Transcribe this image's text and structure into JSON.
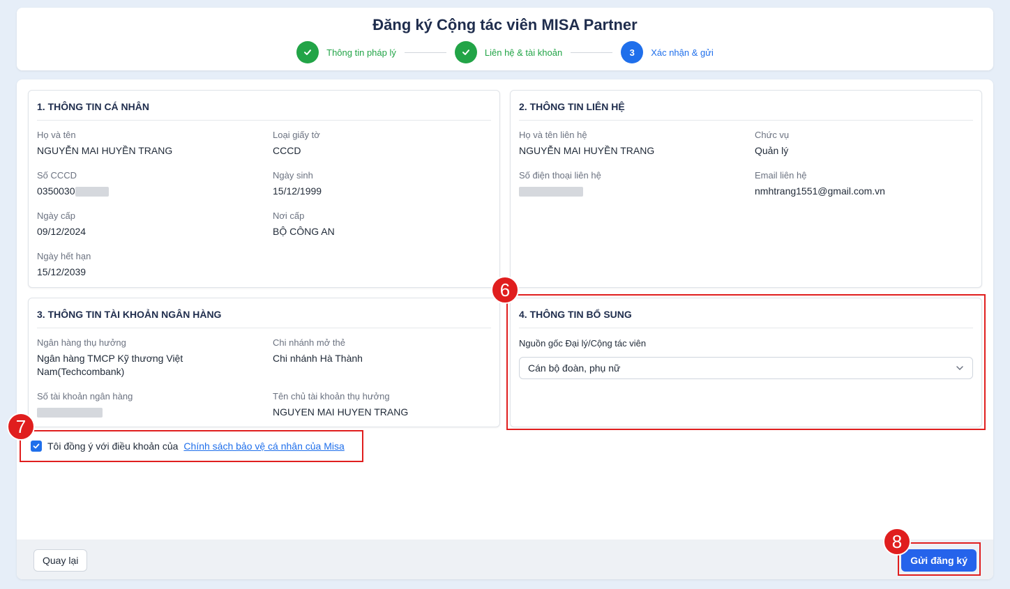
{
  "header": {
    "title": "Đăng ký Cộng tác viên MISA Partner",
    "steps": [
      {
        "label": "Thông tin pháp lý",
        "status": "done"
      },
      {
        "label": "Liên hệ & tài khoản",
        "status": "done"
      },
      {
        "label": "Xác nhận & gửi",
        "status": "active",
        "number": "3"
      }
    ]
  },
  "personal": {
    "title": "1. THÔNG TIN CÁ NHÂN",
    "full_name_label": "Họ và tên",
    "full_name": "NGUYỄN MAI HUYỀN TRANG",
    "doc_type_label": "Loại giấy tờ",
    "doc_type": "CCCD",
    "id_label": "Số CCCD",
    "id_value": "0350030",
    "dob_label": "Ngày sinh",
    "dob": "15/12/1999",
    "issue_date_label": "Ngày cấp",
    "issue_date": "09/12/2024",
    "issue_place_label": "Nơi cấp",
    "issue_place": "BỘ CÔNG AN",
    "expiry_label": "Ngày hết hạn",
    "expiry": "15/12/2039"
  },
  "contact": {
    "title": "2. THÔNG TIN LIÊN HỆ",
    "name_label": "Họ và tên liên hệ",
    "name": "NGUYỄN MAI HUYỀN TRANG",
    "role_label": "Chức vụ",
    "role": "Quản lý",
    "phone_label": "Số điện thoại liên hệ",
    "email_label": "Email liên hệ",
    "email": "nmhtrang1551@gmail.com.vn"
  },
  "bank": {
    "title": "3. THÔNG TIN TÀI KHOẢN NGÂN HÀNG",
    "bank_label": "Ngân hàng thụ hưởng",
    "bank": "Ngân hàng TMCP Kỹ thương Việt Nam(Techcombank)",
    "branch_label": "Chi nhánh mở thẻ",
    "branch": "Chi nhánh Hà Thành",
    "account_label": "Số tài khoản ngân hàng",
    "holder_label": "Tên chủ tài khoản thụ hưởng",
    "holder": "NGUYEN MAI HUYEN TRANG"
  },
  "extra": {
    "title": "4. THÔNG TIN BỔ SUNG",
    "source_label": "Nguồn gốc Đại lý/Cộng tác viên",
    "source_value": "Cán bộ đoàn, phụ nữ"
  },
  "agreement": {
    "text": "Tôi đồng ý với điều khoản của",
    "link": "Chính sách bảo vệ cá nhân của Misa",
    "checked": true
  },
  "footer": {
    "back_label": "Quay lại",
    "submit_label": "Gửi đăng ký"
  },
  "annotations": [
    "6",
    "7",
    "8"
  ],
  "colors": {
    "success": "#22a447",
    "primary": "#1f6feb",
    "annotation": "#e01e1e"
  }
}
